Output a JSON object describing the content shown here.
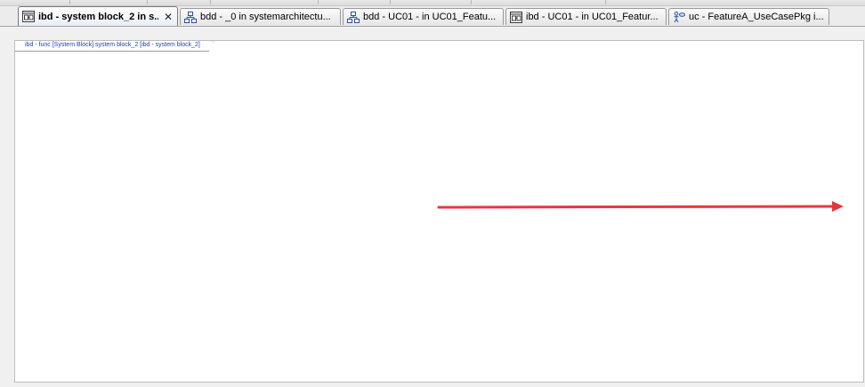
{
  "tabs": [
    {
      "label": "ibd - system block_2 in s...",
      "icon": "ibd-diagram-icon",
      "active": true,
      "closable": true
    },
    {
      "label": "bdd - _0 in systemarchitectu...",
      "icon": "bdd-diagram-icon",
      "active": false,
      "closable": false
    },
    {
      "label": "bdd - UC01 - in UC01_Featu...",
      "icon": "bdd-diagram-icon",
      "active": false,
      "closable": false
    },
    {
      "label": "ibd - UC01 - in UC01_Featur...",
      "icon": "ibd-diagram-icon",
      "active": false,
      "closable": false
    },
    {
      "label": "uc - FeatureA_UseCasePkg i...",
      "icon": "use-case-diagram-icon",
      "active": false,
      "closable": false
    }
  ],
  "close_glyph": "✕",
  "diagram": {
    "frame_label": "ibd - func [System Block] system block_2 [ibd - system block_2]"
  },
  "colors": {
    "frame_text": "#1a3cc8",
    "arrow": "#e8373c",
    "canvas_bg": "#ffffff",
    "chrome_bg": "#f0f0f0"
  }
}
